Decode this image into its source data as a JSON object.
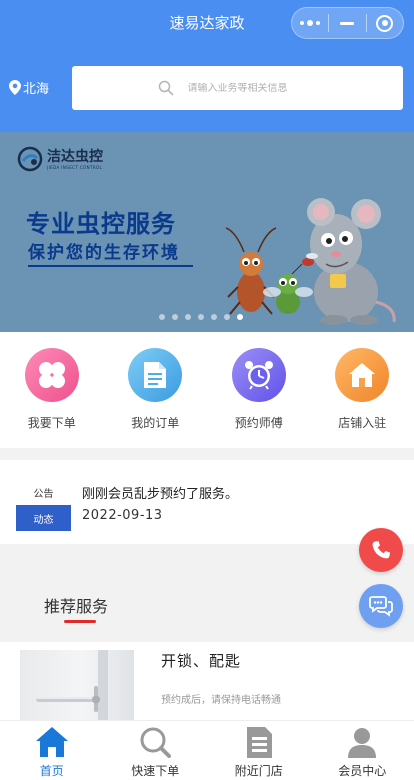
{
  "header": {
    "title": "速易达家政",
    "location": "北海",
    "search_placeholder": "请输入业务等相关信息"
  },
  "banner": {
    "logo_cn": "洁达虫控",
    "logo_en": "JIEDA INSECT CONTROL",
    "headline": "专业虫控服务",
    "subline": "保护您的生存环境",
    "slide_count": 7,
    "active_slide": 7
  },
  "menu": [
    {
      "label": "我要下单",
      "icon": "clover-icon",
      "color": "#f56aa0"
    },
    {
      "label": "我的订单",
      "icon": "document-icon",
      "color": "#4aaee8"
    },
    {
      "label": "预约师傅",
      "icon": "alarm-clock-icon",
      "color": "#7a6ff0"
    },
    {
      "label": "店铺入驻",
      "icon": "house-icon",
      "color": "#f79a3a"
    }
  ],
  "notice": {
    "tag": "公告",
    "badge": "动态",
    "text": "刚刚会员乱步预约了服务。",
    "date": "2022-09-13"
  },
  "recommend": {
    "title": "推荐服务",
    "items": [
      {
        "name": "开锁、配匙",
        "desc": "预约成后，请保持电话畅通"
      }
    ]
  },
  "tabbar": [
    {
      "label": "首页",
      "icon": "home-icon",
      "active": true
    },
    {
      "label": "快速下单",
      "icon": "search-icon",
      "active": false
    },
    {
      "label": "附近门店",
      "icon": "document-icon",
      "active": false
    },
    {
      "label": "会员中心",
      "icon": "user-icon",
      "active": false
    }
  ],
  "colors": {
    "header_bg": "#4a8ef2",
    "banner_bg": "#6a93b4",
    "accent_red": "#e02b2b",
    "active_tab": "#1a78d6"
  }
}
